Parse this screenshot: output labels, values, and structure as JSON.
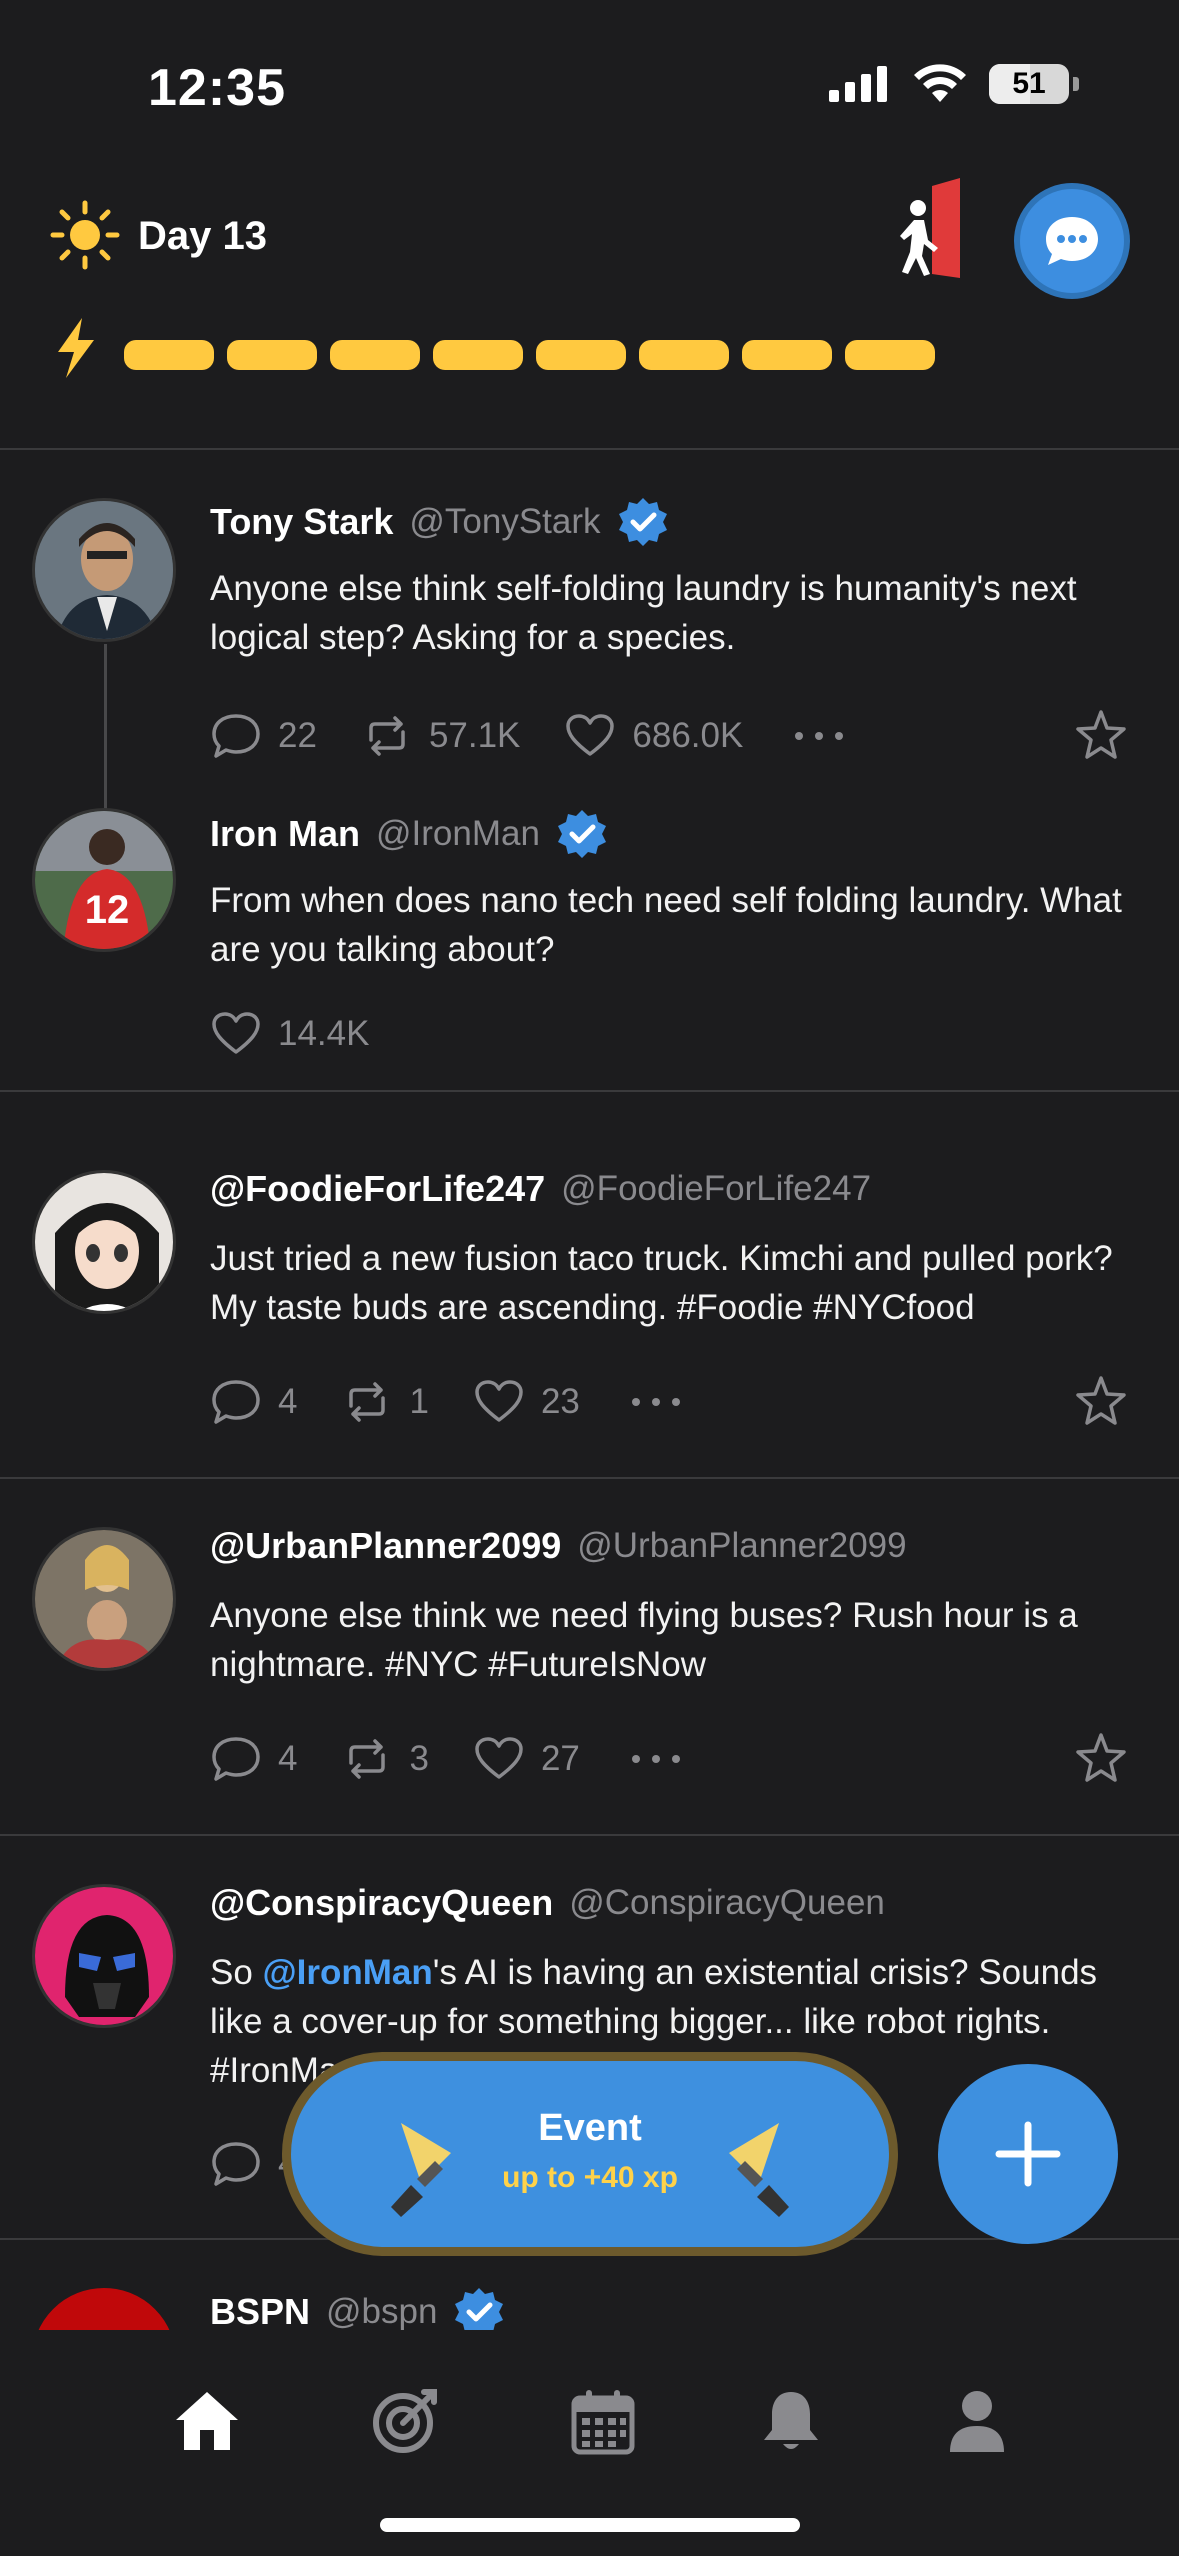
{
  "status_bar": {
    "time": "12:35",
    "battery": "51",
    "battery_level": 0.51
  },
  "header": {
    "day_label": "Day 13",
    "energy_segments": 8,
    "colors": {
      "energy": "#ffc940",
      "accent": "#3d8ee0"
    }
  },
  "posts": [
    {
      "name": "Tony Stark",
      "handle": "@TonyStark",
      "verified": true,
      "text": "Anyone else think self-folding laundry is humanity's next logical step? Asking for a species.",
      "replies": "22",
      "reposts": "57.1K",
      "likes": "686.0K"
    },
    {
      "name": "Iron Man",
      "handle": "@IronMan",
      "verified": true,
      "text": "From when does nano tech need self folding laundry. What are you talking about?",
      "likes": "14.4K"
    },
    {
      "name": "@FoodieForLife247",
      "handle": "@FoodieForLife247",
      "text": "Just tried a new fusion taco truck. Kimchi and pulled pork? My taste buds are ascending. #Foodie #NYCfood",
      "replies": "4",
      "reposts": "1",
      "likes": "23"
    },
    {
      "name": "@UrbanPlanner2099",
      "handle": "@UrbanPlanner2099",
      "text": "Anyone else think we need flying buses? Rush hour is a nightmare. #NYC #FutureIsNow",
      "replies": "4",
      "reposts": "3",
      "likes": "27"
    },
    {
      "name": "@ConspiracyQueen",
      "handle": "@ConspiracyQueen",
      "text_mention": "@IronMan",
      "text_rest": "'s AI is having an existential crisis? Sounds like a cover-up for something bigger... like robot rights. #IronMan #RobotUprising",
      "text_prefix": "So ",
      "replies": "4"
    },
    {
      "name": "BSPN",
      "handle": "@bspn",
      "verified": true
    }
  ],
  "event": {
    "title": "Event",
    "subtitle": "up to +40 xp"
  },
  "nav": {
    "items": [
      "home-icon",
      "target-icon",
      "calendar-icon",
      "bell-icon",
      "profile-icon"
    ],
    "active": "home-icon"
  }
}
